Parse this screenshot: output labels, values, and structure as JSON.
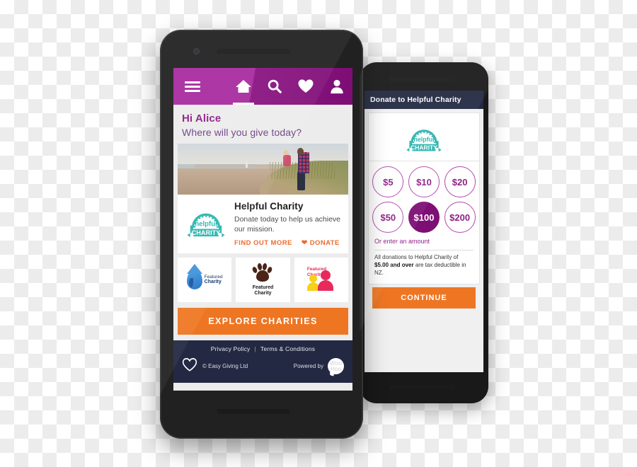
{
  "app": {
    "front_phone": {
      "nav": {
        "menu_icon": "hamburger-menu-icon",
        "items": [
          {
            "icon": "home-icon",
            "label": "Home",
            "active": true
          },
          {
            "icon": "search-icon",
            "label": "Search",
            "active": false
          },
          {
            "icon": "heart-icon",
            "label": "Favourites",
            "active": false
          },
          {
            "icon": "user-icon",
            "label": "Account",
            "active": false
          }
        ]
      },
      "greeting": {
        "title": "Hi Alice",
        "subtitle": "Where will you give today?"
      },
      "hero": {
        "alt": "Man holding child on a beach at dusk"
      },
      "charity_card": {
        "badge_top_text": "helpful",
        "badge_bottom_text": "CHARITY",
        "title": "Helpful Charity",
        "description": "Donate today to help us achieve our mission.",
        "find_out_more_label": "FIND OUT MORE",
        "donate_label": "DONATE"
      },
      "featured_tiles": [
        {
          "icon": "water-drop-icon",
          "label_small": "Featured",
          "label_bold": "Charity"
        },
        {
          "icon": "paw-print-icon",
          "label_line1": "Featured",
          "label_line2": "Charity"
        },
        {
          "icon": "two-people-icon",
          "label_line1": "Featured",
          "label_line2": "Charity"
        }
      ],
      "explore_button_label": "EXPLORE CHARITIES",
      "footer": {
        "privacy_label": "Privacy Policy",
        "separator": "|",
        "terms_label": "Terms & Conditions",
        "heart_icon": "heart-outline-icon",
        "copyright": "© Easy Giving Ltd",
        "powered_by_label": "Powered by",
        "brand_line1": "Woo",
        "brand_line2": "Hoo"
      }
    },
    "back_phone": {
      "header_title": "Donate to Helpful Charity",
      "badge_top_text": "helpful",
      "badge_bottom_text": "CHARITY",
      "amounts": [
        {
          "label": "$5",
          "selected": false
        },
        {
          "label": "$10",
          "selected": false
        },
        {
          "label": "$20",
          "selected": false
        },
        {
          "label": "$50",
          "selected": false
        },
        {
          "label": "$100",
          "selected": true
        },
        {
          "label": "$200",
          "selected": false
        }
      ],
      "other_amount_label": "Or enter an amount",
      "tax_note_part1": "All donations to Helpful Charity of ",
      "tax_note_bold1": "$5.00",
      "tax_note_bold2": "and over",
      "tax_note_part2": " are tax deductible in NZ.",
      "continue_label": "CONTINUE"
    }
  },
  "colors": {
    "purple": "#9b2192",
    "purple_dark": "#7d0e75",
    "orange": "#ee7623",
    "navy": "#232942",
    "teal": "#2ab5af",
    "magenta_link": "#8e1f86"
  }
}
